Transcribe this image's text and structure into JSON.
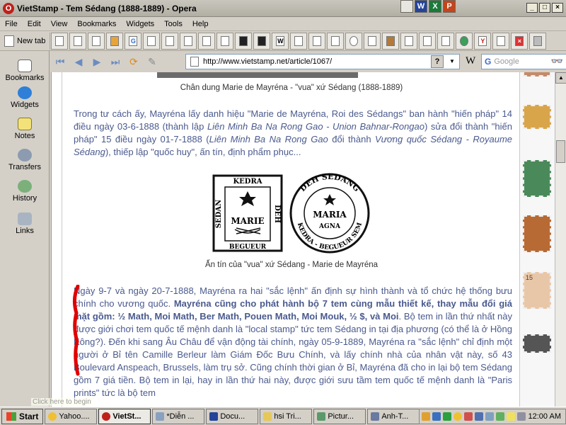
{
  "window": {
    "title": "VietStamp - Tem Sédang (1888-1889) - Opera"
  },
  "menu": {
    "items": [
      "File",
      "Edit",
      "View",
      "Bookmarks",
      "Widgets",
      "Tools",
      "Help"
    ]
  },
  "tabs": {
    "new_tab_label": "New tab"
  },
  "nav": {
    "url": "http://www.vietstamp.net/article/1067/",
    "search_engine": "Google"
  },
  "panel": {
    "items": [
      "Bookmarks",
      "Widgets",
      "Notes",
      "Transfers",
      "History",
      "Links"
    ]
  },
  "page": {
    "caption_top": "Chân dung Marie de Mayréna - \"vua\" xứ Sédang (1888-1889)",
    "para1_a": "Trong tư cách ấy, Mayréna lấy danh hiệu \"Marie de Mayréna, Roi des Sédangs\" ban hành \"hiến pháp\" 14 điều ngày  03-6-1888 (thành lập ",
    "para1_i1": "Liên Minh Ba Na Rong Gao - Union Bahnar-Rongao",
    "para1_b": ") sửa đổi thành \"hiến pháp\" 15 điều ngày 01-7-1888 (",
    "para1_i2": "Liên Minh Ba Na Rong Gao",
    "para1_c": " đổi thành ",
    "para1_i3": "Vương quốc Sédang - Royaume Sédang",
    "para1_d": "), thiếp lập \"quốc huy\", ấn tín, định phẩm phục...",
    "seal_left": {
      "top": "KEDRA",
      "left": "SEDAN",
      "right": "DEH",
      "center": "MARIE",
      "bottom": "BEGUEUR"
    },
    "seal_right": {
      "ring_top": "DEH SEDANG",
      "ring_bottom": "KEDRA - BEGUEUR SEM",
      "center_top": "MARIA",
      "center_bottom": "AGNA"
    },
    "caption_seals": "Ấn tín của \"vua\" xứ Sédang - Marie de Mayréna",
    "para2_a": "Ngày 9-7 và ngày 20-7-1888, Mayréna ra hai \"sắc lệnh\" ấn định sự hình thành và tổ chức hệ thống bưu chính cho vương quốc. ",
    "para2_bold": "Mayréna cũng cho phát hành bộ 7 tem cùng mẫu thiết kế, thay mẫu đổi giá mặt gồm: ½ Math, Moi Math, Ber Math, Pouen Math, Moi Mouk, ½ $, và Moi",
    "para2_b": ". Bộ tem in lần thứ nhất này được giới chơi tem quốc tế mệnh danh là \"local stamp\" tức tem Sédang in tại địa phương (có thể là ở Hồng Kông?). Đến khi sang Âu Châu để vận động tài chính, ngày  05-9-1889, Mayréna ra \"sắc lệnh\" chỉ định một người ở Bỉ tên Camille Berleur làm Giám Đốc Bưu Chính, và lấy chính nhà của nhân vật này, số 43 Boulevard Anspeach, Brussels, làm trụ sở. Cũng chính thời gian ở Bỉ, Mayréna đã cho in lại bộ tem Sédang gồm 7 giá tiền. Bộ tem in lại, hay in lần thứ hai này, được giới sưu tầm tem quốc tế mệnh danh là \"Paris prints\" tức là bộ tem"
  },
  "stamps_sidebar": {
    "stamp4_value": "15"
  },
  "tooltip": "Click here to begin",
  "taskbar": {
    "start": "Start",
    "tasks": [
      "Yahoo....",
      "VietSt...",
      "*Diễn ...",
      "Docu...",
      "hsi Tri...",
      "Pictur...",
      "Anh-T..."
    ],
    "clock": "12:00 AM"
  },
  "colors": {
    "body_text": "#4a5a8e",
    "title_gradient": "#c9c6bd",
    "red_mark": "#e00000"
  }
}
